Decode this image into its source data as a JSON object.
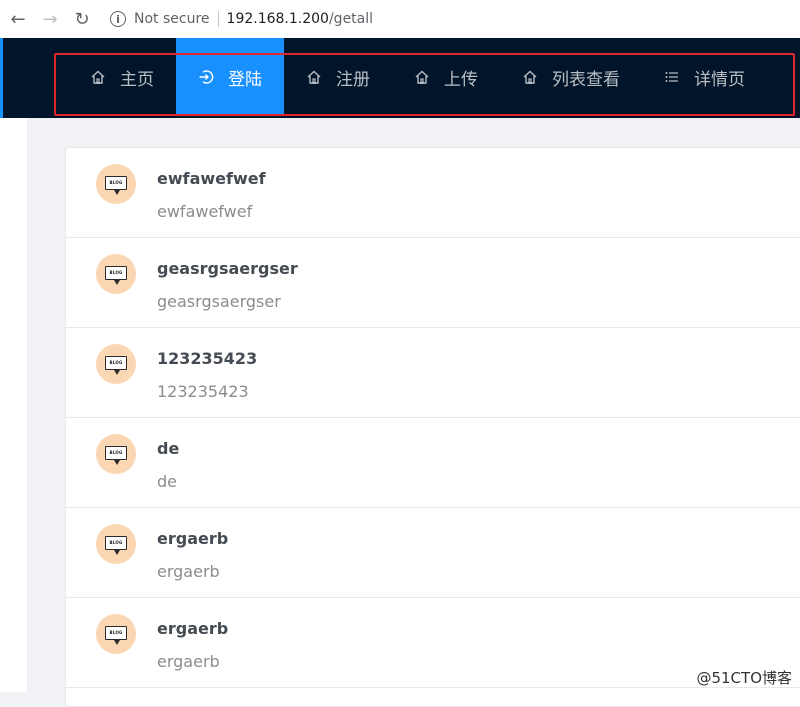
{
  "browser": {
    "security_label": "Not secure",
    "url_host": "192.168.1.200",
    "url_path": "/getall"
  },
  "nav": {
    "items": [
      {
        "label": "主页",
        "icon": "home-icon",
        "active": false
      },
      {
        "label": "登陆",
        "icon": "login-icon",
        "active": true
      },
      {
        "label": "注册",
        "icon": "home-icon",
        "active": false
      },
      {
        "label": "上传",
        "icon": "home-icon",
        "active": false
      },
      {
        "label": "列表查看",
        "icon": "home-icon",
        "active": false
      },
      {
        "label": "详情页",
        "icon": "list-icon",
        "active": false
      }
    ]
  },
  "list": {
    "avatar_text": "BLOG",
    "items": [
      {
        "title": "ewfawefwef",
        "description": "ewfawefwef"
      },
      {
        "title": "geasrgsaergser",
        "description": "geasrgsaergser"
      },
      {
        "title": "123235423",
        "description": "123235423"
      },
      {
        "title": "de",
        "description": "de"
      },
      {
        "title": "ergaerb",
        "description": "ergaerb"
      },
      {
        "title": "ergaerb",
        "description": "ergaerb"
      }
    ]
  },
  "watermark": "@51CTO博客",
  "colors": {
    "nav_bg": "#001529",
    "active_bg": "#1890ff",
    "highlight_border": "#e0262a",
    "avatar_bg": "#fbd6b2"
  }
}
